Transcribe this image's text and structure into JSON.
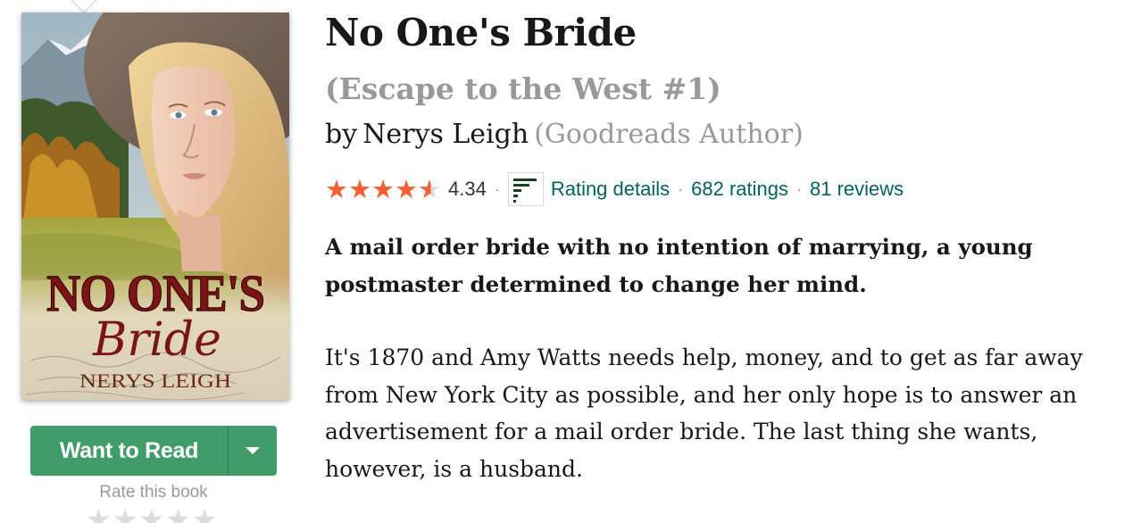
{
  "book": {
    "title": "No One's Bride",
    "series": "(Escape to the West #1)",
    "by": "by",
    "author": "Nerys Leigh",
    "author_role": "(Goodreads Author)",
    "rating_value": 4.34,
    "average_rating": "4.34",
    "rating_details_label": "Rating details",
    "ratings_count": "682 ratings",
    "reviews_count": "81 reviews",
    "separator": "·",
    "blurb_headline": "A mail order bride with no intention of marrying, a young postmaster determined to change her mind.",
    "blurb_body": "It's 1870 and Amy Watts needs help, money, and to get as far away from New York City as possible, and her only hope is to answer an advertisement for a mail order bride. The last thing she wants, however, is a husband."
  },
  "cover": {
    "title_line1": "NO ONE'S",
    "title_line2": "Bride",
    "author": "NERYS LEIGH"
  },
  "actions": {
    "want_to_read_label": "Want to Read",
    "rate_label": "Rate this book",
    "rate_stars_filled": 0,
    "rate_stars_total": 5
  },
  "colors": {
    "star_fill": "#f55f34",
    "button_green": "#409d69",
    "link_teal": "#00635d",
    "muted_gray": "#999999"
  },
  "icons": {
    "rating_details": "bar-chart-icon",
    "dropdown": "chevron-down-icon",
    "rating_star": "star-icon"
  }
}
